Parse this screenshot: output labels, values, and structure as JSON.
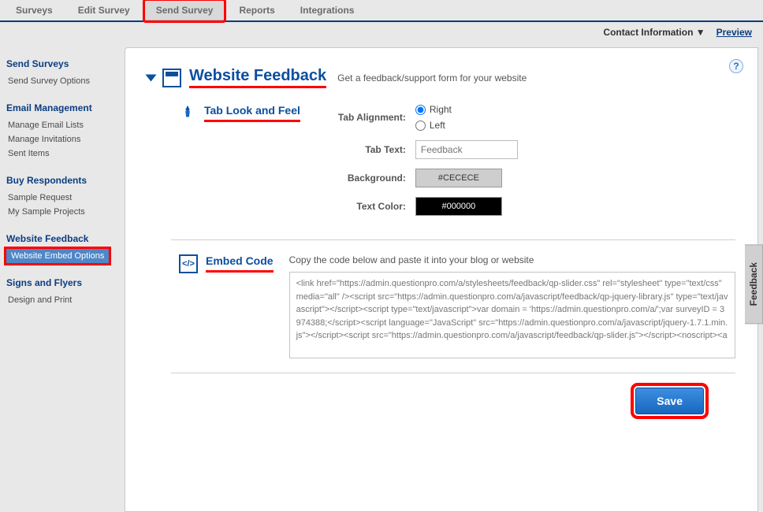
{
  "topnav": {
    "items": [
      "Surveys",
      "Edit Survey",
      "Send Survey",
      "Reports",
      "Integrations"
    ],
    "active_index": 2
  },
  "subbar": {
    "contact": "Contact Information ▼",
    "preview": "Preview"
  },
  "sidebar": {
    "groups": [
      {
        "title": "Send Surveys",
        "items": [
          "Send Survey Options"
        ]
      },
      {
        "title": "Email Management",
        "items": [
          "Manage Email Lists",
          "Manage Invitations",
          "Sent Items"
        ]
      },
      {
        "title": "Buy Respondents",
        "items": [
          "Sample Request",
          "My Sample Projects"
        ]
      },
      {
        "title": "Website Feedback",
        "items": [
          "Website Embed Options"
        ],
        "active_item": 0
      },
      {
        "title": "Signs and Flyers",
        "items": [
          "Design and Print"
        ]
      }
    ]
  },
  "panel": {
    "help": "?"
  },
  "header": {
    "title": "Website Feedback",
    "subtitle": "Get a feedback/support form for your website"
  },
  "look": {
    "title": "Tab Look and Feel",
    "labels": {
      "alignment": "Tab Alignment:",
      "text": "Tab Text:",
      "background": "Background:",
      "textcolor": "Text Color:"
    },
    "alignment_options": {
      "right": "Right",
      "left": "Left"
    },
    "alignment_selected": "right",
    "text_placeholder": "Feedback",
    "background_value": "#CECECE",
    "textcolor_value": "#000000"
  },
  "embed": {
    "title": "Embed Code",
    "hint": "Copy the code below and paste it into your blog or website",
    "code": "<link href=\"https://admin.questionpro.com/a/stylesheets/feedback/qp-slider.css\" rel=\"stylesheet\" type=\"text/css\" media=\"all\" /><script src=\"https://admin.questionpro.com/a/javascript/feedback/qp-jquery-library.js\" type=\"text/javascript\"></script><script type=\"text/javascript\">var domain = 'https://admin.questionpro.com/a/';var surveyID = 3974388;</script><script language=\"JavaScript\" src=\"https://admin.questionpro.com/a/javascript/jquery-1.7.1.min.js\"></script><script src=\"https://admin.questionpro.com/a/javascript/feedback/qp-slider.js\"></script><noscript><a"
  },
  "save": {
    "label": "Save"
  },
  "feedback_tab": {
    "label": "Feedback"
  }
}
